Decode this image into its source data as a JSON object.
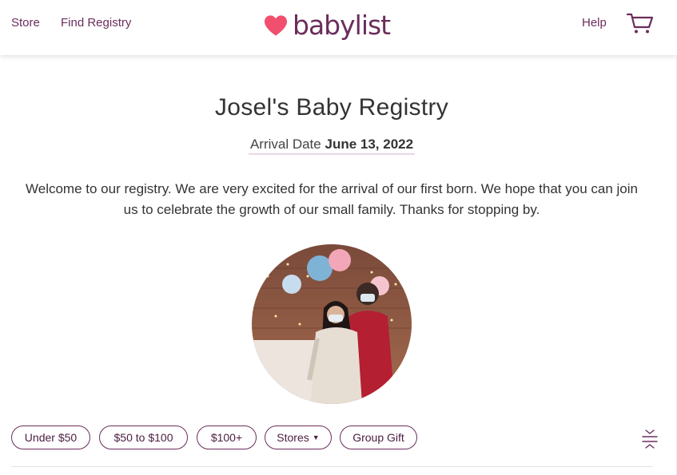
{
  "header": {
    "store_label": "Store",
    "find_registry_label": "Find Registry",
    "logo_text": "babylist",
    "help_label": "Help",
    "brand_color": "#6b2d5c",
    "heart_color": "#f0506e"
  },
  "registry": {
    "title": "Josel's Baby Registry",
    "arrival_label": "Arrival Date",
    "arrival_date": "June 13, 2022",
    "welcome_message": "Welcome to our registry. We are very excited for the arrival of our first born. We hope that you can join us to celebrate the growth of our small family. Thanks for stopping by."
  },
  "filters": {
    "under_50": "Under $50",
    "range_50_100": "$50 to $100",
    "over_100": "$100+",
    "stores": "Stores",
    "group_gift": "Group Gift"
  },
  "icons": {
    "cart": "cart-icon",
    "heart": "heart-logo-icon",
    "collapse": "collapse-icon"
  }
}
